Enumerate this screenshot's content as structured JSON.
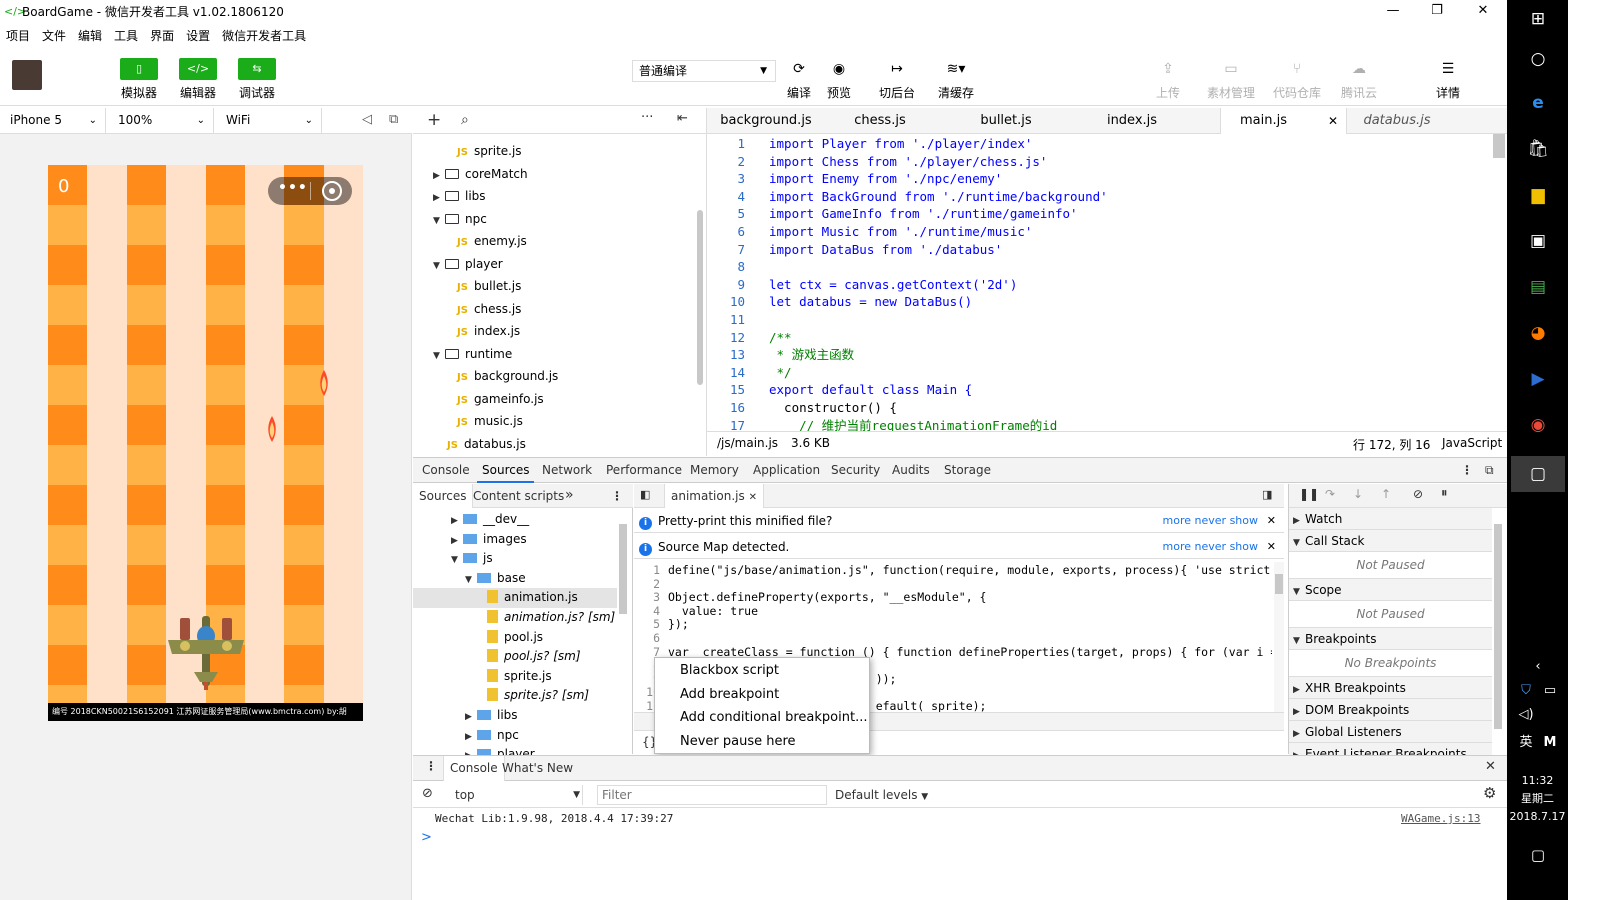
{
  "window": {
    "title": "BoardGame - 微信开发者工具 v1.02.1806120"
  },
  "menu": [
    "项目",
    "文件",
    "编辑",
    "工具",
    "界面",
    "设置",
    "微信开发者工具"
  ],
  "toolbar": {
    "simulator": "模拟器",
    "editor": "编辑器",
    "debugger": "调试器",
    "compile_mode": "普通编译",
    "compile": "编译",
    "preview": "预览",
    "background": "切后台",
    "clear_cache": "清缓存",
    "upload": "上传",
    "assets": "素材管理",
    "repo": "代码仓库",
    "cloud": "腾讯云",
    "details": "详情"
  },
  "device": {
    "model": "iPhone 5",
    "zoom": "100%",
    "network": "WiFi"
  },
  "game": {
    "score": "0",
    "footer": "编号 2018CKN50021S6152091 江苏网证服务管理局(www.bmctra.com) by:胡"
  },
  "file_tree": [
    {
      "name": "sprite.js",
      "type": "js",
      "depth": 2
    },
    {
      "name": "coreMatch",
      "type": "folder",
      "depth": 1,
      "open": false
    },
    {
      "name": "libs",
      "type": "folder",
      "depth": 1,
      "open": false
    },
    {
      "name": "npc",
      "type": "folder",
      "depth": 1,
      "open": true
    },
    {
      "name": "enemy.js",
      "type": "js",
      "depth": 2
    },
    {
      "name": "player",
      "type": "folder",
      "depth": 1,
      "open": true
    },
    {
      "name": "bullet.js",
      "type": "js",
      "depth": 2
    },
    {
      "name": "chess.js",
      "type": "js",
      "depth": 2
    },
    {
      "name": "index.js",
      "type": "js",
      "depth": 2
    },
    {
      "name": "runtime",
      "type": "folder",
      "depth": 1,
      "open": true
    },
    {
      "name": "background.js",
      "type": "js",
      "depth": 2
    },
    {
      "name": "gameinfo.js",
      "type": "js",
      "depth": 2
    },
    {
      "name": "music.js",
      "type": "js",
      "depth": 2
    },
    {
      "name": "databus.js",
      "type": "js",
      "depth": 1
    }
  ],
  "editor": {
    "tabs": [
      "background.js",
      "chess.js",
      "bullet.js",
      "index.js",
      "main.js",
      "databus.js"
    ],
    "active_tab": "main.js",
    "lines": [
      [
        "1",
        "import Player from './player/index'"
      ],
      [
        "2",
        "import Chess from './player/chess.js'"
      ],
      [
        "3",
        "import Enemy from './npc/enemy'"
      ],
      [
        "4",
        "import BackGround from './runtime/background'"
      ],
      [
        "5",
        "import GameInfo from './runtime/gameinfo'"
      ],
      [
        "6",
        "import Music from './runtime/music'"
      ],
      [
        "7",
        "import DataBus from './databus'"
      ],
      [
        "8",
        ""
      ],
      [
        "9",
        "let ctx = canvas.getContext('2d')"
      ],
      [
        "10",
        "let databus = new DataBus()"
      ],
      [
        "11",
        ""
      ],
      [
        "12",
        "/**"
      ],
      [
        "13",
        " * 游戏主函数"
      ],
      [
        "14",
        " */"
      ],
      [
        "15",
        "export default class Main {"
      ],
      [
        "16",
        "  constructor() {"
      ],
      [
        "17",
        "    // 维护当前requestAnimationFrame的id"
      ]
    ],
    "status": {
      "path": "/js/main.js",
      "size": "3.6 KB",
      "position": "行 172, 列 16",
      "language": "JavaScript"
    }
  },
  "devtools": {
    "tabs": [
      "Console",
      "Sources",
      "Network",
      "Performance",
      "Memory",
      "Application",
      "Security",
      "Audits",
      "Storage"
    ],
    "active_tab": "Sources",
    "nav_tabs": [
      "Sources",
      "Content scripts"
    ],
    "nav_more": "»",
    "nav_tree": [
      {
        "name": "__dev__",
        "type": "folder",
        "depth": 1,
        "open": false
      },
      {
        "name": "images",
        "type": "folder",
        "depth": 1,
        "open": false
      },
      {
        "name": "js",
        "type": "folder",
        "depth": 1,
        "open": true
      },
      {
        "name": "base",
        "type": "folder",
        "depth": 2,
        "open": true
      },
      {
        "name": "animation.js",
        "type": "file",
        "depth": 3,
        "selected": true
      },
      {
        "name": "animation.js? [sm]",
        "type": "file",
        "depth": 3,
        "italic": true
      },
      {
        "name": "pool.js",
        "type": "file",
        "depth": 3
      },
      {
        "name": "pool.js? [sm]",
        "type": "file",
        "depth": 3,
        "italic": true
      },
      {
        "name": "sprite.js",
        "type": "file",
        "depth": 3
      },
      {
        "name": "sprite.js? [sm]",
        "type": "file",
        "depth": 3,
        "italic": true
      },
      {
        "name": "libs",
        "type": "folder",
        "depth": 2,
        "open": false
      },
      {
        "name": "npc",
        "type": "folder",
        "depth": 2,
        "open": false
      },
      {
        "name": "player",
        "type": "folder",
        "depth": 2,
        "open": false
      }
    ],
    "open_file": "animation.js",
    "info_bars": [
      {
        "text": "Pretty-print this minified file?",
        "more": "more",
        "never": "never show"
      },
      {
        "text": "Source Map detected.",
        "more": "more",
        "never": "never show"
      }
    ],
    "source_lines": [
      [
        "1",
        "define(\"js/base/animation.js\", function(require, module, exports, process){ 'use strict';"
      ],
      [
        "2",
        ""
      ],
      [
        "3",
        "Object.defineProperty(exports, \"__esModule\", {"
      ],
      [
        "4",
        "  value: true"
      ],
      [
        "5",
        "});"
      ],
      [
        "6",
        ""
      ],
      [
        "7",
        "var _createClass = function () { function defineProperties(target, props) { for (var i = 0; i"
      ],
      [
        "8",
        ""
      ],
      [
        "9",
        "                              ));"
      ],
      [
        "10",
        ""
      ],
      [
        "11",
        "                              efault( sprite);"
      ]
    ],
    "source_footer": "{}",
    "context_menu": [
      "Blackbox script",
      "Add breakpoint",
      "Add conditional breakpoint...",
      "Never pause here"
    ],
    "debugger_sections": [
      {
        "title": "Watch",
        "sub": ""
      },
      {
        "title": "Call Stack",
        "sub": "Not Paused"
      },
      {
        "title": "Scope",
        "sub": "Not Paused"
      },
      {
        "title": "Breakpoints",
        "sub": "No Breakpoints"
      },
      {
        "title": "XHR Breakpoints",
        "sub": ""
      },
      {
        "title": "DOM Breakpoints",
        "sub": ""
      },
      {
        "title": "Global Listeners",
        "sub": ""
      },
      {
        "title": "Event Listener Breakpoints",
        "sub": ""
      }
    ]
  },
  "console": {
    "tabs": [
      "Console",
      "What's New"
    ],
    "context": "top",
    "filter_placeholder": "Filter",
    "levels": "Default levels",
    "message": "Wechat Lib:1.9.98, 2018.4.4 17:39:27",
    "message_source": "WAGame.js:13",
    "prompt": ">"
  },
  "taskbar": {
    "time": "11:32",
    "weekday": "星期二",
    "date": "2018.7.17",
    "ime": "英",
    "ime2": "M"
  },
  "colors": {
    "wechat_green": "#1aad19",
    "dark_orange": "#ff8c1a",
    "light_orange": "#ffb347",
    "cream": "#ffe0c8",
    "link_blue": "#1a73e8"
  }
}
